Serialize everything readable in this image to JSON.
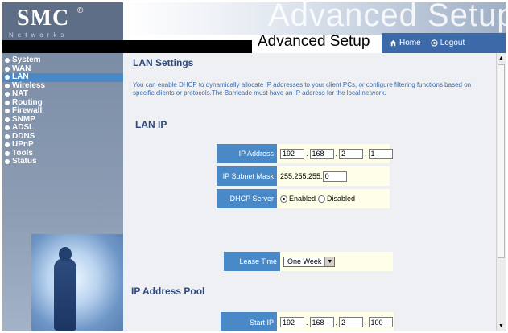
{
  "brand": {
    "logo": "SMC",
    "registered": "®",
    "tagline": "Networks"
  },
  "header": {
    "watermark": "Advanced Setup",
    "title": "Advanced Setup"
  },
  "topnav": {
    "home": "Home",
    "logout": "Logout"
  },
  "sidebar": {
    "items": [
      {
        "label": "System",
        "active": false
      },
      {
        "label": "WAN",
        "active": false
      },
      {
        "label": "LAN",
        "active": true
      },
      {
        "label": "Wireless",
        "active": false
      },
      {
        "label": "NAT",
        "active": false
      },
      {
        "label": "Routing",
        "active": false
      },
      {
        "label": "Firewall",
        "active": false
      },
      {
        "label": "SNMP",
        "active": false
      },
      {
        "label": "ADSL",
        "active": false
      },
      {
        "label": "DDNS",
        "active": false
      },
      {
        "label": "UPnP",
        "active": false
      },
      {
        "label": "Tools",
        "active": false
      },
      {
        "label": "Status",
        "active": false
      }
    ]
  },
  "main": {
    "heading": "LAN Settings",
    "description": "You can enable DHCP to dynamically allocate IP addresses to your client PCs, or configure filtering functions based on specific clients or protocols.The Barricade must have an IP address for the local network.",
    "lan_ip": {
      "heading": "LAN IP",
      "ip_address": {
        "label": "IP Address",
        "octets": [
          "192",
          "168",
          "2",
          "1"
        ]
      },
      "subnet_mask": {
        "label": "IP Subnet Mask",
        "prefix": "255.255.255.",
        "last": "0"
      },
      "dhcp_server": {
        "label": "DHCP Server",
        "enabled_label": "Enabled",
        "disabled_label": "Disabled",
        "selected": "Enabled"
      }
    },
    "lease_time": {
      "label": "Lease Time",
      "value": "One Week"
    },
    "pool": {
      "heading": "IP Address Pool",
      "start_ip": {
        "label": "Start IP",
        "octets": [
          "192",
          "168",
          "2",
          "100"
        ]
      }
    }
  },
  "colors": {
    "accent": "#4a89c8",
    "heading": "#2f4a7a",
    "value_bg": "#fffee8",
    "sidebar": "#8b9cb3"
  }
}
